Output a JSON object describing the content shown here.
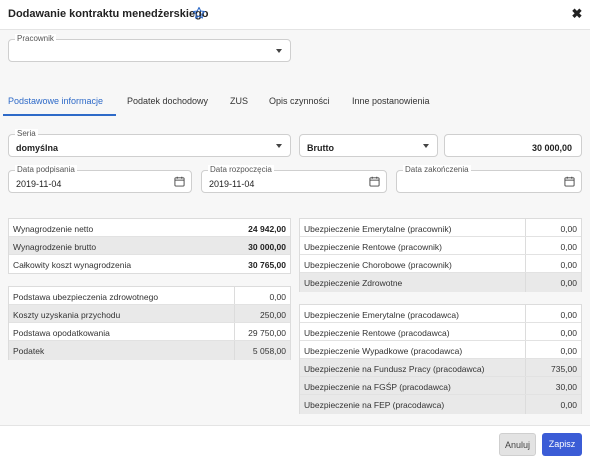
{
  "dialog": {
    "title": "Dodawanie kontraktu menedżerskiego",
    "close_symbol": "✖"
  },
  "employee": {
    "label": "Pracownik",
    "value": ""
  },
  "tabs": [
    {
      "label": "Podstawowe informacje",
      "active": true
    },
    {
      "label": "Podatek dochodowy",
      "active": false
    },
    {
      "label": "ZUS",
      "active": false
    },
    {
      "label": "Opis czynności",
      "active": false
    },
    {
      "label": "Inne postanowienia",
      "active": false
    }
  ],
  "form": {
    "series": {
      "label": "Seria",
      "value": "domyślna"
    },
    "amount_type": {
      "value": "Brutto"
    },
    "amount": {
      "value": "30 000,00"
    },
    "signed_date": {
      "label": "Data podpisania",
      "value": "2019-11-04"
    },
    "start_date": {
      "label": "Data rozpoczęcia",
      "value": "2019-11-04"
    },
    "end_date": {
      "label": "Data zakończenia",
      "value": ""
    }
  },
  "summary_table": [
    {
      "label": "Wynagrodzenie netto",
      "value": "24 942,00"
    },
    {
      "label": "Wynagrodzenie brutto",
      "value": "30 000,00"
    },
    {
      "label": "Całkowity koszt wynagrodzenia",
      "value": "30 765,00"
    }
  ],
  "tax_table": [
    {
      "label": "Podstawa ubezpieczenia zdrowotnego",
      "value": "0,00"
    },
    {
      "label": "Koszty uzyskania przychodu",
      "value": "250,00"
    },
    {
      "label": "Podstawa opodatkowania",
      "value": "29 750,00"
    },
    {
      "label": "Podatek",
      "value": "5 058,00"
    }
  ],
  "employee_insurance_table": [
    {
      "label": "Ubezpieczenie Emerytalne (pracownik)",
      "value": "0,00"
    },
    {
      "label": "Ubezpieczenie Rentowe (pracownik)",
      "value": "0,00"
    },
    {
      "label": "Ubezpieczenie Chorobowe (pracownik)",
      "value": "0,00"
    },
    {
      "label": "Ubezpieczenie Zdrowotne",
      "value": "0,00"
    }
  ],
  "employer_insurance_table": [
    {
      "label": "Ubezpieczenie Emerytalne (pracodawca)",
      "value": "0,00"
    },
    {
      "label": "Ubezpieczenie Rentowe (pracodawca)",
      "value": "0,00"
    },
    {
      "label": "Ubezpieczenie Wypadkowe (pracodawca)",
      "value": "0,00"
    },
    {
      "label": "Ubezpieczenie na Fundusz Pracy (pracodawca)",
      "value": "735,00"
    },
    {
      "label": "Ubezpieczenie na FGŚP (pracodawca)",
      "value": "30,00"
    },
    {
      "label": "Ubezpieczenie na FEP (pracodawca)",
      "value": "0,00"
    }
  ],
  "footer": {
    "cancel_label": "Anuluj",
    "save_label": "Zapisz"
  },
  "colors": {
    "accent": "#2e6ac8",
    "save_button": "#3b5cd6",
    "shaded_row": "#e9e9e9"
  },
  "icons": {
    "favorite": "star-icon",
    "close": "close-icon",
    "dropdown": "chevron-down-icon",
    "date": "calendar-icon"
  }
}
